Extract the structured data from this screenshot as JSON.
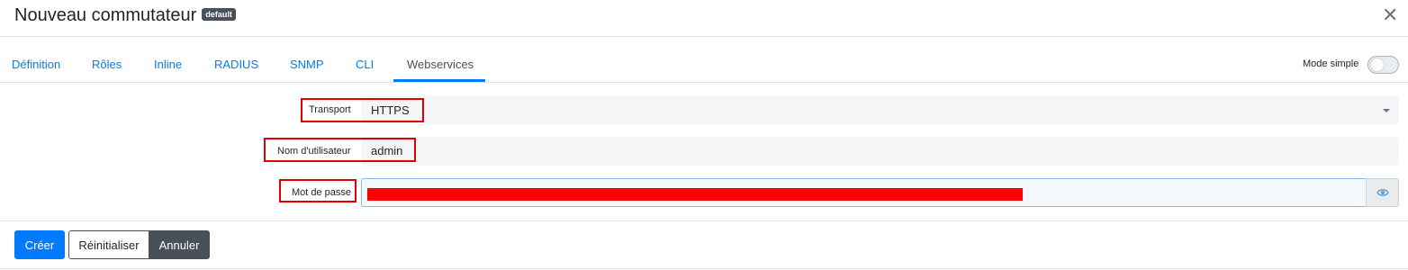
{
  "header": {
    "title": "Nouveau commutateur",
    "badge": "default",
    "close_icon": "close-icon"
  },
  "tabs": [
    {
      "label": "Définition",
      "active": false
    },
    {
      "label": "Rôles",
      "active": false
    },
    {
      "label": "Inline",
      "active": false
    },
    {
      "label": "RADIUS",
      "active": false
    },
    {
      "label": "SNMP",
      "active": false
    },
    {
      "label": "CLI",
      "active": false
    },
    {
      "label": "Webservices",
      "active": true
    }
  ],
  "mode_toggle": {
    "label": "Mode simple",
    "on": false
  },
  "form": {
    "transport": {
      "label": "Transport",
      "value": "HTTPS"
    },
    "username": {
      "label": "Nom d'utilisateur",
      "value": "admin"
    },
    "password": {
      "label": "Mot de passe",
      "value_redacted": true,
      "reveal_icon": "eye-icon"
    }
  },
  "footer": {
    "create_label": "Créer",
    "reset_label": "Réinitialiser",
    "cancel_label": "Annuler"
  },
  "colors": {
    "accent": "#007bff",
    "highlight": "#e00000",
    "dark": "#495057"
  }
}
